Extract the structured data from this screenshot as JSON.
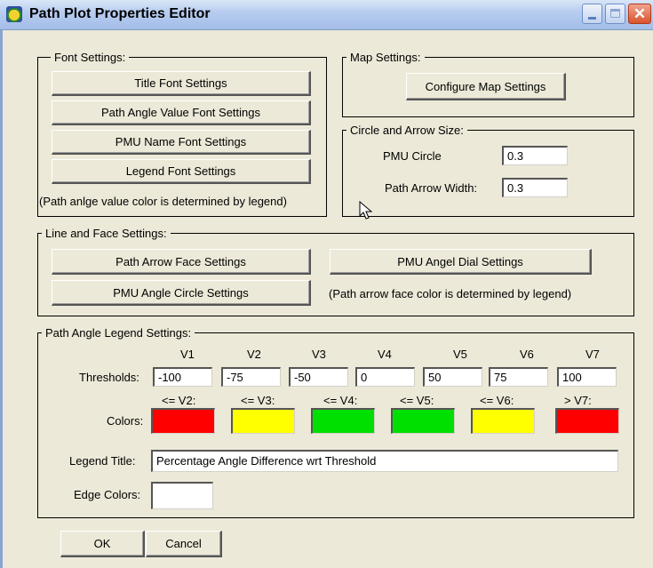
{
  "window": {
    "title": "Path Plot Properties Editor"
  },
  "font_settings": {
    "title": "Font Settings:",
    "buttons": [
      "Title Font Settings",
      "Path Angle Value Font Settings",
      "PMU Name Font Settings",
      "Legend Font Settings"
    ],
    "note": "(Path anlge value color is determined by legend)"
  },
  "map_settings": {
    "title": "Map Settings:",
    "button": "Configure Map Settings"
  },
  "circle_arrow": {
    "title": "Circle and Arrow Size:",
    "pmu_circle_label": "PMU Circle",
    "pmu_circle_value": "0.3",
    "arrow_width_label": "Path Arrow Width:",
    "arrow_width_value": "0.3"
  },
  "line_face": {
    "title": "Line and Face Settings:",
    "arrow_face_button": "Path Arrow Face Settings",
    "dial_button": "PMU Angel Dial Settings",
    "circle_button": "PMU Angle Circle Settings",
    "note": "(Path arrow face color is determined by legend)"
  },
  "legend": {
    "title": "Path Angle Legend Settings:",
    "headers": [
      "V1",
      "V2",
      "V3",
      "V4",
      "V5",
      "V6",
      "V7"
    ],
    "thresholds_label": "Thresholds:",
    "thresholds": [
      "-100",
      "-75",
      "-50",
      "0",
      "50",
      "75",
      "100"
    ],
    "color_headers": [
      "<= V2:",
      "<= V3:",
      "<= V4:",
      "<= V5:",
      "<= V6:",
      "> V7:"
    ],
    "colors_label": "Colors:",
    "colors": [
      "#ff0000",
      "#ffff00",
      "#00e000",
      "#00e000",
      "#ffff00",
      "#ff0000"
    ],
    "legend_title_label": "Legend Title:",
    "legend_title_value": "Percentage Angle Difference wrt Threshold",
    "edge_colors_label": "Edge Colors:",
    "edge_color": "#ffffff"
  },
  "buttons": {
    "ok": "OK",
    "cancel": "Cancel"
  }
}
